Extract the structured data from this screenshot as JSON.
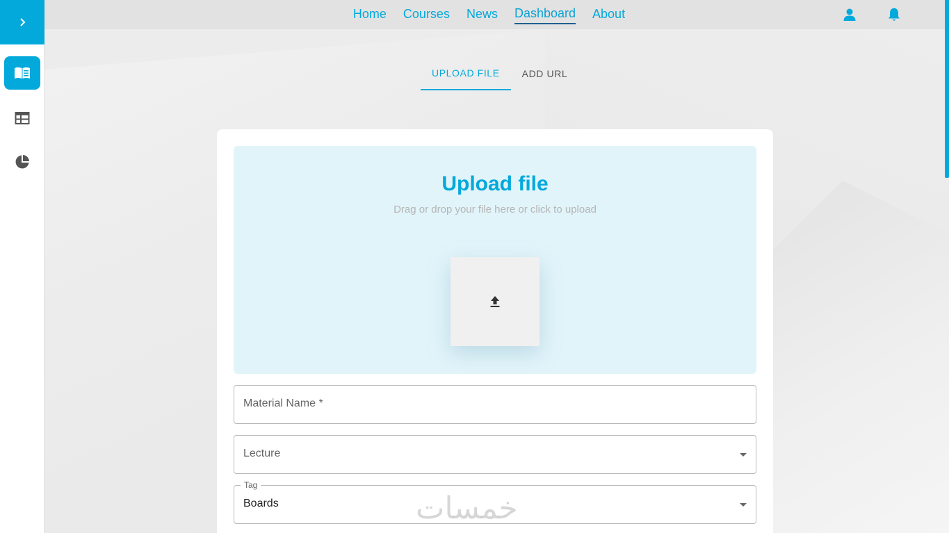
{
  "colors": {
    "accent": "#03a9db",
    "topbar": "#e2e2e2",
    "dropzone": "#e1f4fa"
  },
  "sidebar": {
    "toggle_icon": "chevron-right-icon",
    "items": [
      {
        "icon": "book-open-icon",
        "active": true
      },
      {
        "icon": "table-layout-icon",
        "active": false
      },
      {
        "icon": "pie-chart-icon",
        "active": false
      }
    ]
  },
  "nav": {
    "links": [
      "Home",
      "Courses",
      "News",
      "Dashboard",
      "About"
    ],
    "active": "Dashboard",
    "icons": [
      "user-icon",
      "bell-icon"
    ]
  },
  "tabs": {
    "items": [
      "UPLOAD FILE",
      "ADD URL"
    ],
    "active": "UPLOAD FILE"
  },
  "upload": {
    "title": "Upload file",
    "subtitle": "Drag or drop your file here or click to upload",
    "icon": "upload-icon"
  },
  "form": {
    "material_name": {
      "label": "Material Name *"
    },
    "lecture": {
      "label": "Lecture"
    },
    "tag": {
      "label": "Tag",
      "value": "Boards"
    }
  },
  "watermark": "خمسات"
}
